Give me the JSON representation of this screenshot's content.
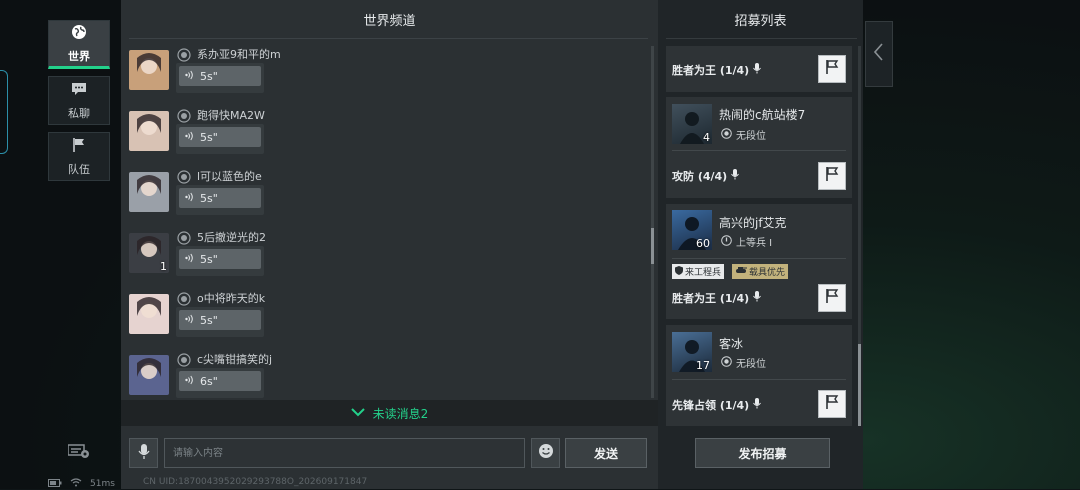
{
  "nav": {
    "tabs": [
      {
        "label": "世界",
        "icon": "globe-icon",
        "active": true
      },
      {
        "label": "私聊",
        "icon": "chat-bubble-icon",
        "active": false
      },
      {
        "label": "队伍",
        "icon": "flag-icon",
        "active": false
      }
    ],
    "status": {
      "ping": "51ms"
    }
  },
  "world": {
    "title": "世界频道",
    "messages": [
      {
        "name": "系办亚9和平的m",
        "duration": "5s\"",
        "level": "",
        "avatar_color": "#c8a07a"
      },
      {
        "name": "跑得快MA2W",
        "duration": "5s\"",
        "level": "",
        "avatar_color": "#d8c2b4"
      },
      {
        "name": "l可以蓝色的e",
        "duration": "5s\"",
        "level": "",
        "avatar_color": "#9aa0a8"
      },
      {
        "name": "5后撤逆光的2",
        "duration": "5s\"",
        "level": "1",
        "avatar_color": "#3b3e44"
      },
      {
        "name": "o中将昨天的k",
        "duration": "5s\"",
        "level": "",
        "avatar_color": "#e6d3d0"
      },
      {
        "name": "c尖嘴钳搞笑的j",
        "duration": "6s\"",
        "level": "",
        "avatar_color": "#5b6490"
      }
    ],
    "unread": "未读消息2",
    "input_placeholder": "请输入内容",
    "send_label": "发送",
    "uid": "CN UID:1870043952029293788O_202609171847"
  },
  "recruit": {
    "title": "招募列表",
    "cards": [
      {
        "mode": "胜者为王 (1/4)"
      },
      {
        "player": "热闹的c航站楼7",
        "rank": "无段位",
        "level": "4",
        "mode": "攻防 (4/4)"
      },
      {
        "player": "高兴的jf艾克",
        "rank": "上等兵 I",
        "level": "60",
        "tags": [
          "来工程兵",
          "载具优先"
        ],
        "mode": "胜者为王 (1/4)"
      },
      {
        "player": "客冰",
        "rank": "无段位",
        "level": "17",
        "mode": "先锋占领 (1/4)"
      }
    ],
    "publish_label": "发布招募"
  },
  "colors": {
    "accent": "#23d18b",
    "panel": "#2b3033",
    "recruit_panel": "#202528"
  }
}
